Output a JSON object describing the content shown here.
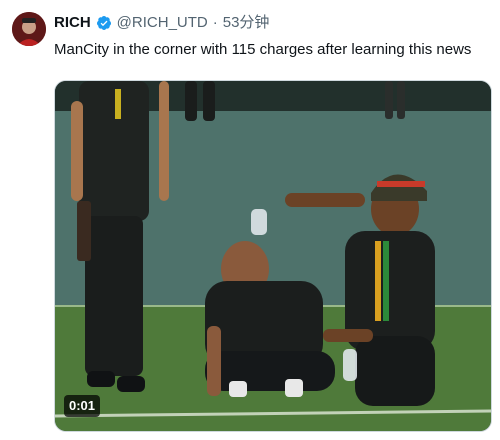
{
  "tweet": {
    "display_name": "RICH",
    "handle": "@RICH_UTD",
    "separator": "·",
    "timestamp": "53分钟",
    "verified_icon": "verified-badge-icon",
    "text": "ManCity in the corner with 115 charges after learning this news"
  },
  "media": {
    "type": "video",
    "duration": "0:01"
  },
  "colors": {
    "verified": "#1d9bf0",
    "secondary_text": "#536471",
    "primary_text": "#0f1419",
    "pitch_green": "#4f7a3a"
  }
}
